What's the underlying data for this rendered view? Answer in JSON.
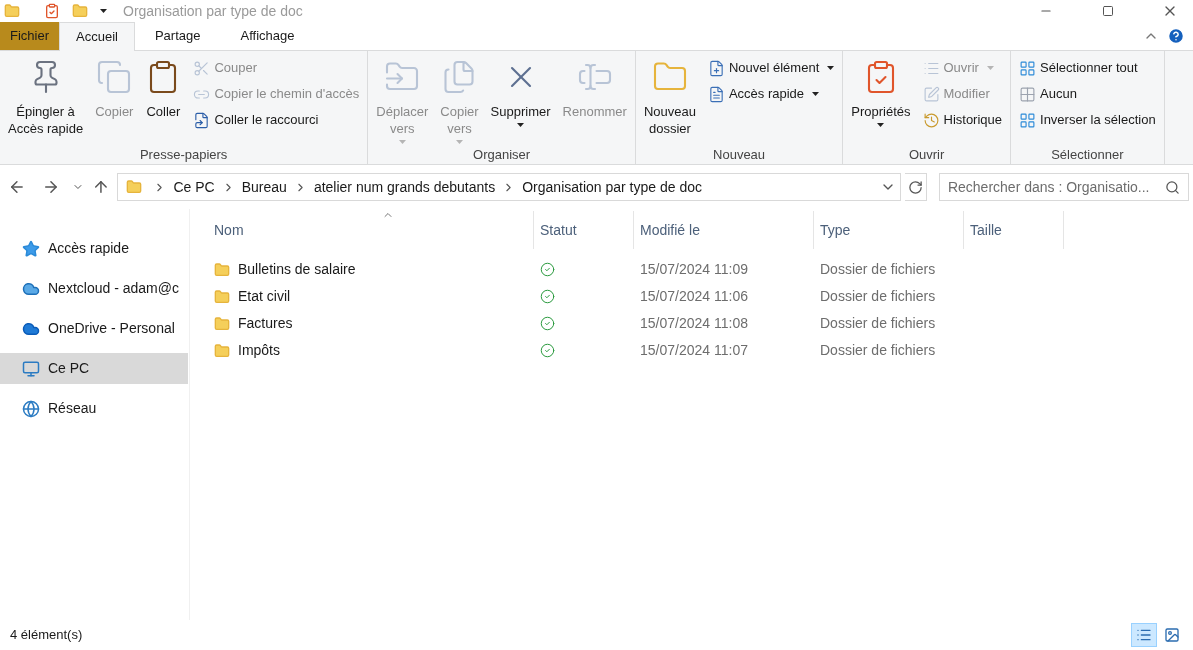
{
  "window": {
    "title": "Organisation par type de doc"
  },
  "ribbon_tabs": [
    {
      "label": "Fichier",
      "kind": "file",
      "selected": false
    },
    {
      "label": "Accueil",
      "kind": "tab",
      "selected": true
    },
    {
      "label": "Partage",
      "kind": "tab",
      "selected": false
    },
    {
      "label": "Affichage",
      "kind": "tab",
      "selected": false
    }
  ],
  "ribbon_groups": [
    {
      "label": "Presse-papiers",
      "items": [
        {
          "kind": "large",
          "label": "Épingler à\nAccès rapide",
          "disabled": false,
          "menu": false
        },
        {
          "kind": "large",
          "label": "Copier",
          "disabled": true,
          "menu": false
        },
        {
          "kind": "large",
          "label": "Coller",
          "disabled": false,
          "menu": false
        },
        {
          "kind": "small",
          "label": "Couper",
          "disabled": true,
          "menu": false
        },
        {
          "kind": "small",
          "label": "Copier le chemin d'accès",
          "disabled": true,
          "menu": false
        },
        {
          "kind": "small",
          "label": "Coller le raccourci",
          "disabled": false,
          "menu": false
        }
      ]
    },
    {
      "label": "Organiser",
      "items": [
        {
          "kind": "large",
          "label": "Déplacer\nvers",
          "disabled": true,
          "menu": true
        },
        {
          "kind": "large",
          "label": "Copier\nvers",
          "disabled": true,
          "menu": true
        },
        {
          "kind": "large",
          "label": "Supprimer",
          "disabled": false,
          "menu": true
        },
        {
          "kind": "large",
          "label": "Renommer",
          "disabled": true,
          "menu": false
        }
      ]
    },
    {
      "label": "Nouveau",
      "items": [
        {
          "kind": "large",
          "label": "Nouveau\ndossier",
          "disabled": false,
          "menu": false
        },
        {
          "kind": "small",
          "label": "Nouvel élément",
          "disabled": false,
          "menu": true
        },
        {
          "kind": "small",
          "label": "Accès rapide",
          "disabled": false,
          "menu": true
        }
      ]
    },
    {
      "label": "Ouvrir",
      "items": [
        {
          "kind": "large",
          "label": "Propriétés",
          "disabled": false,
          "menu": true
        },
        {
          "kind": "small",
          "label": "Ouvrir",
          "disabled": true,
          "menu": true
        },
        {
          "kind": "small",
          "label": "Modifier",
          "disabled": true,
          "menu": false
        },
        {
          "kind": "small",
          "label": "Historique",
          "disabled": false,
          "menu": false
        }
      ]
    },
    {
      "label": "Sélectionner",
      "items": [
        {
          "kind": "small",
          "label": "Sélectionner tout",
          "disabled": false,
          "menu": false
        },
        {
          "kind": "small",
          "label": "Aucun",
          "disabled": false,
          "menu": false
        },
        {
          "kind": "small",
          "label": "Inverser la sélection",
          "disabled": false,
          "menu": false
        }
      ]
    }
  ],
  "address_bar": {
    "path": [
      "Ce PC",
      "Bureau",
      "atelier num grands debutants",
      "Organisation par type de doc"
    ]
  },
  "search": {
    "placeholder": "Rechercher dans : Organisatio..."
  },
  "sidebar": {
    "items": [
      {
        "label": "Accès rapide",
        "selected": false
      },
      {
        "label": "Nextcloud - adam@c",
        "selected": false
      },
      {
        "label": "OneDrive - Personal",
        "selected": false
      },
      {
        "label": "Ce PC",
        "selected": true
      },
      {
        "label": "Réseau",
        "selected": false
      }
    ]
  },
  "table": {
    "columns": [
      "Nom",
      "Statut",
      "Modifié le",
      "Type",
      "Taille"
    ],
    "rows": [
      {
        "name": "Bulletins de salaire",
        "synced": true,
        "modified": "15/07/2024 11:09",
        "type": "Dossier de fichiers"
      },
      {
        "name": "Etat civil",
        "synced": true,
        "modified": "15/07/2024 11:06",
        "type": "Dossier de fichiers"
      },
      {
        "name": "Factures",
        "synced": true,
        "modified": "15/07/2024 11:08",
        "type": "Dossier de fichiers"
      },
      {
        "name": "Impôts",
        "synced": true,
        "modified": "15/07/2024 11:07",
        "type": "Dossier de fichiers"
      }
    ]
  },
  "status_bar": {
    "count": "4 élément(s)"
  },
  "view_buttons": [
    {
      "kind": "details",
      "selected": true
    },
    {
      "kind": "tiles",
      "selected": false
    }
  ]
}
